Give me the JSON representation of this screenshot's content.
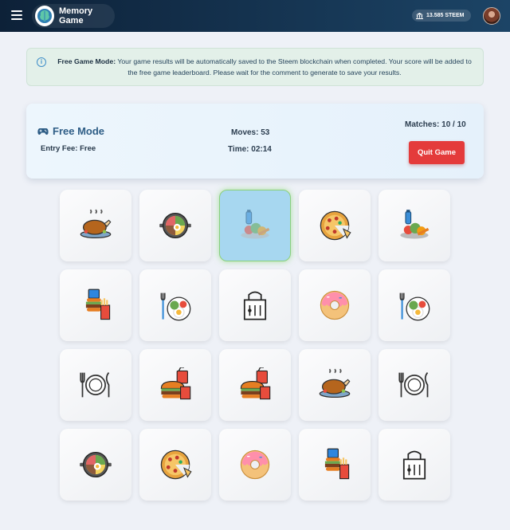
{
  "header": {
    "app_title": "Memory Game",
    "wallet_balance": "13.585 STEEM"
  },
  "notice": {
    "bold_label": "Free Game Mode:",
    "message": "Your game results will be automatically saved to the Steem blockchain when completed. Your score will be added to the free game leaderboard. Please wait for the comment to generate to save your results."
  },
  "status": {
    "mode_label": "Free Mode",
    "entry_fee_label": "Entry Fee: Free",
    "moves_label": "Moves:",
    "moves_value": "53",
    "time_label": "Time:",
    "time_value": "02:14",
    "matches_label": "Matches:",
    "matches_value": "10 / 10",
    "quit_button": "Quit Game"
  },
  "board": {
    "rows": [
      [
        "roast-chicken-icon",
        "bibimbap-icon",
        "healthy-food-icon",
        "pizza-icon",
        "healthy-food-icon"
      ],
      [
        "fast-food-icon",
        "breakfast-plate-icon",
        "takeaway-bag-icon",
        "donut-icon",
        "breakfast-plate-icon"
      ],
      [
        "plate-cutlery-icon",
        "burger-combo-icon",
        "burger-combo-icon",
        "roast-chicken-icon",
        "plate-cutlery-icon"
      ],
      [
        "bibimbap-icon",
        "pizza-icon",
        "donut-icon",
        "fast-food-icon",
        "takeaway-bag-icon"
      ]
    ],
    "selected": [
      0,
      2
    ]
  }
}
